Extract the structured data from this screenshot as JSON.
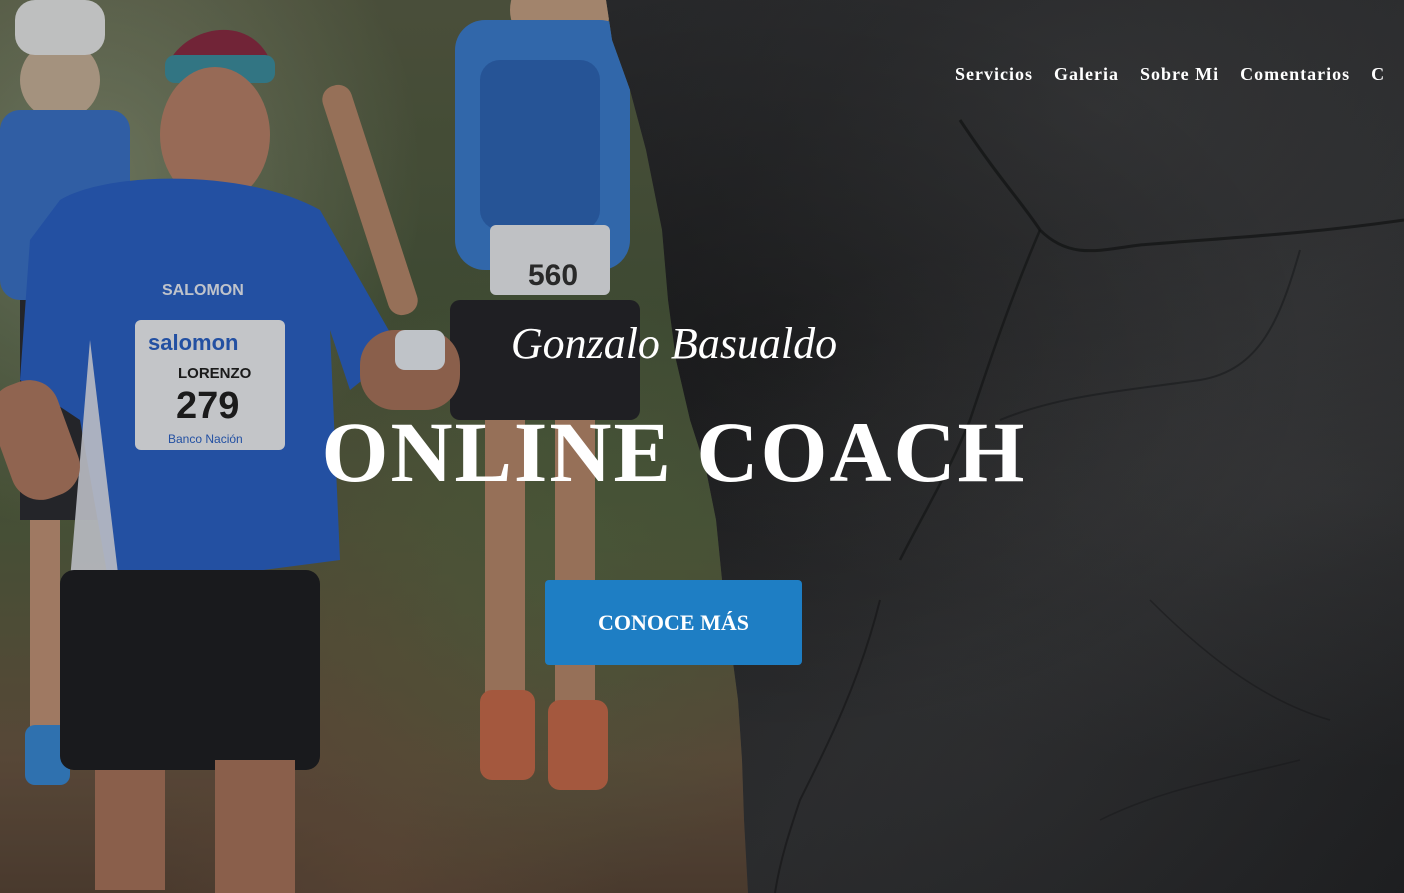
{
  "nav": {
    "items": [
      {
        "label": "Servicios"
      },
      {
        "label": "Galeria"
      },
      {
        "label": "Sobre Mi"
      },
      {
        "label": "Comentarios"
      },
      {
        "label": "C"
      }
    ]
  },
  "hero": {
    "subtitle": "Gonzalo Basualdo",
    "title": "ONLINE COACH",
    "cta_label": "CONOCE MÁS"
  },
  "photo": {
    "bibs": [
      {
        "brand": "salomon",
        "name": "LORENZO",
        "number": "279",
        "sponsor": "Banco Nación"
      },
      {
        "number": "560"
      }
    ],
    "shirt_brand": "SALOMON"
  },
  "colors": {
    "cta": "#1e7ec4",
    "stone": "#232426",
    "text": "#ffffff"
  }
}
